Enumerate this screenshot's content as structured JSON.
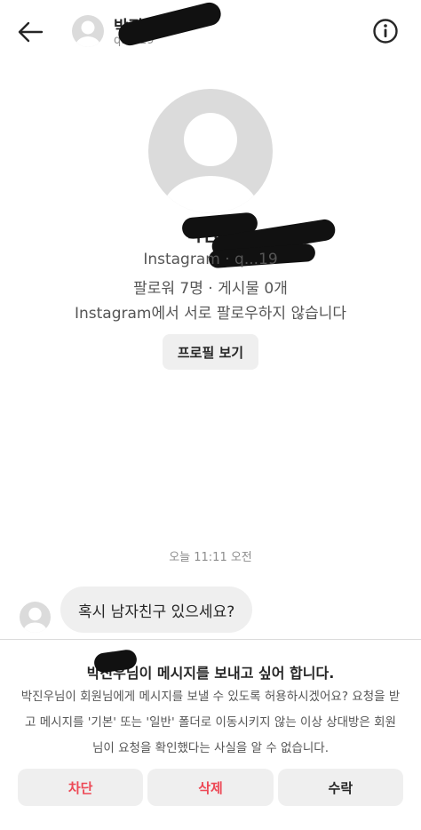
{
  "header": {
    "name": "박진우",
    "subtitle": "q...119"
  },
  "profile": {
    "name": "박진우",
    "instagram_line": "Instagram · q...19",
    "stats": "팔로워 7명 · 게시물 0개",
    "mutual": "Instagram에서 서로 팔로우하지 않습니다",
    "view_profile_label": "프로필 보기"
  },
  "chat": {
    "timestamp": "오늘 11:11 오전",
    "message": "혹시 남자친구 있으세요?"
  },
  "request": {
    "title": "박진우님이 메시지를 보내고 싶어 합니다.",
    "description": "박진우님이 회원님에게 메시지를 보낼 수 있도록 허용하시겠어요? 요청을 받고 메시지를 '기본' 또는 '일반' 폴더로 이동시키지 않는 이상 상대방은 회원님이 요청을 확인했다는 사실을 알 수 없습니다.",
    "block_label": "차단",
    "delete_label": "삭제",
    "accept_label": "수락"
  },
  "colors": {
    "danger": "#ed4956",
    "text": "#262626",
    "button_bg": "#efefef",
    "avatar_bg": "#dbdbdb"
  },
  "icons": {
    "back": "arrow-left-icon",
    "info": "info-circle-icon",
    "avatar": "default-avatar-icon"
  }
}
